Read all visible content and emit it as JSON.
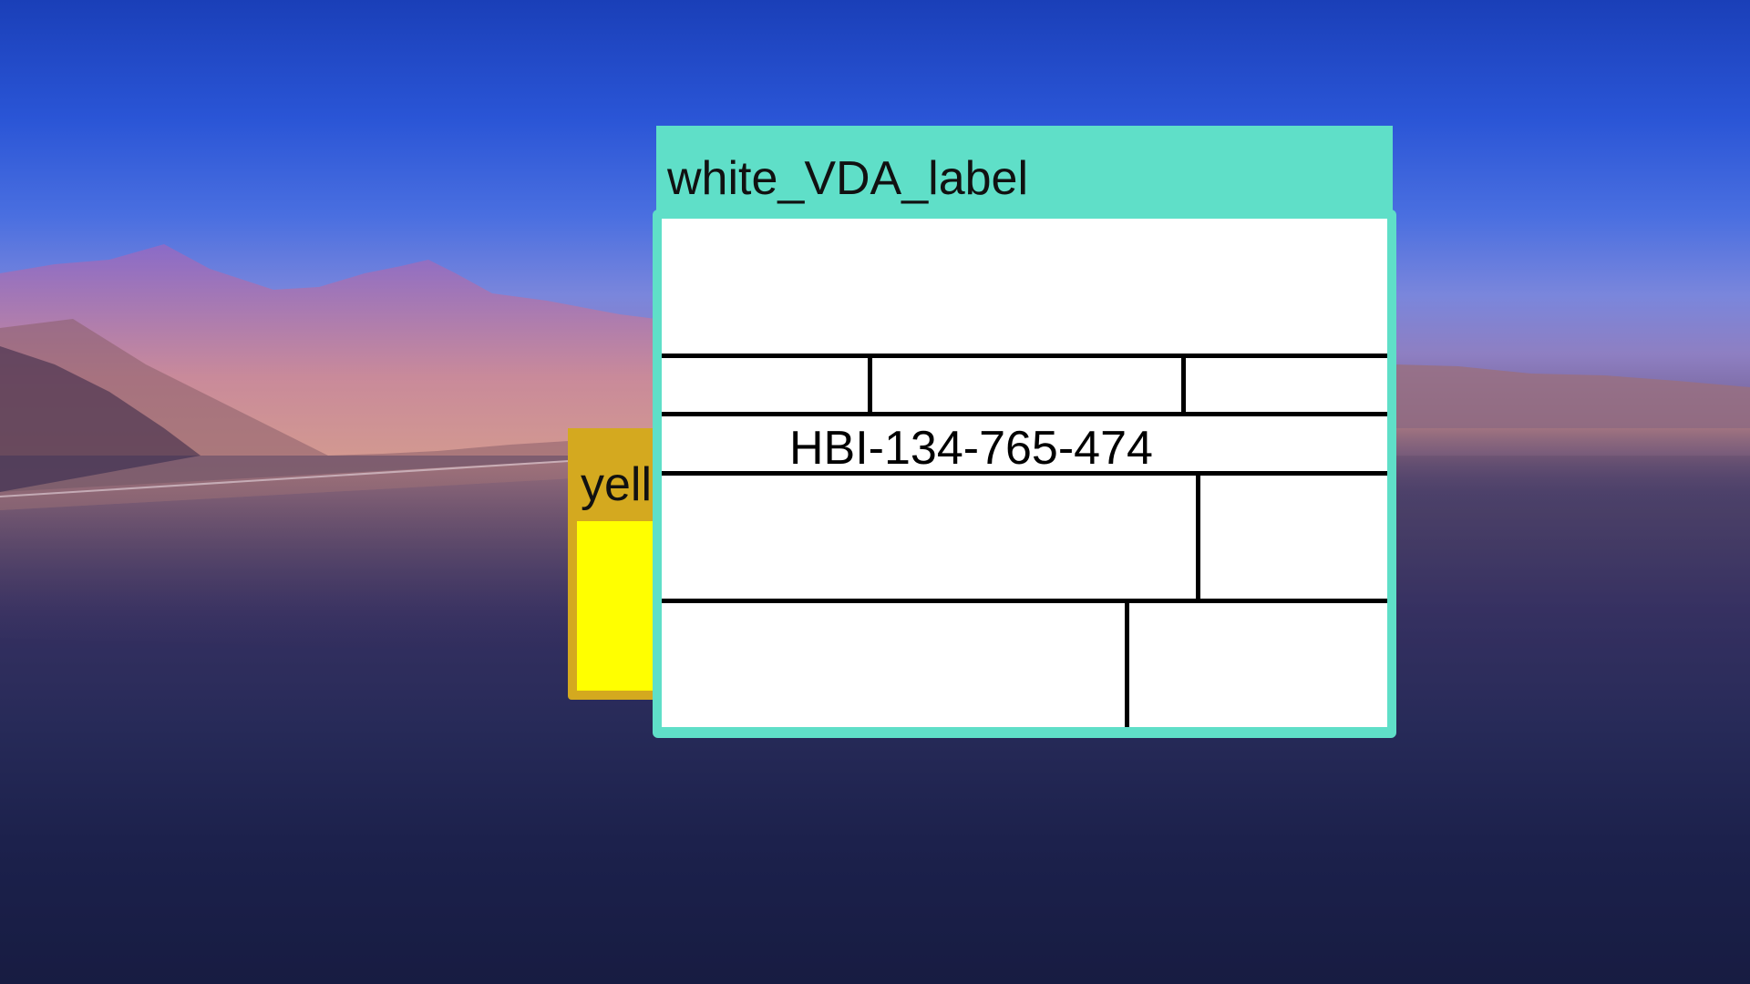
{
  "desktop": {
    "wallpaper": "mountain-lake-landscape"
  },
  "windows": {
    "yellow": {
      "title": "yellow_VDA_label",
      "accent_color": "#d4a91f",
      "content_color": "#ffff00"
    },
    "teal": {
      "title": "white_VDA_label",
      "accent_color": "#5fdfc8",
      "label": {
        "serial": "HBI-134-765-474"
      }
    }
  }
}
